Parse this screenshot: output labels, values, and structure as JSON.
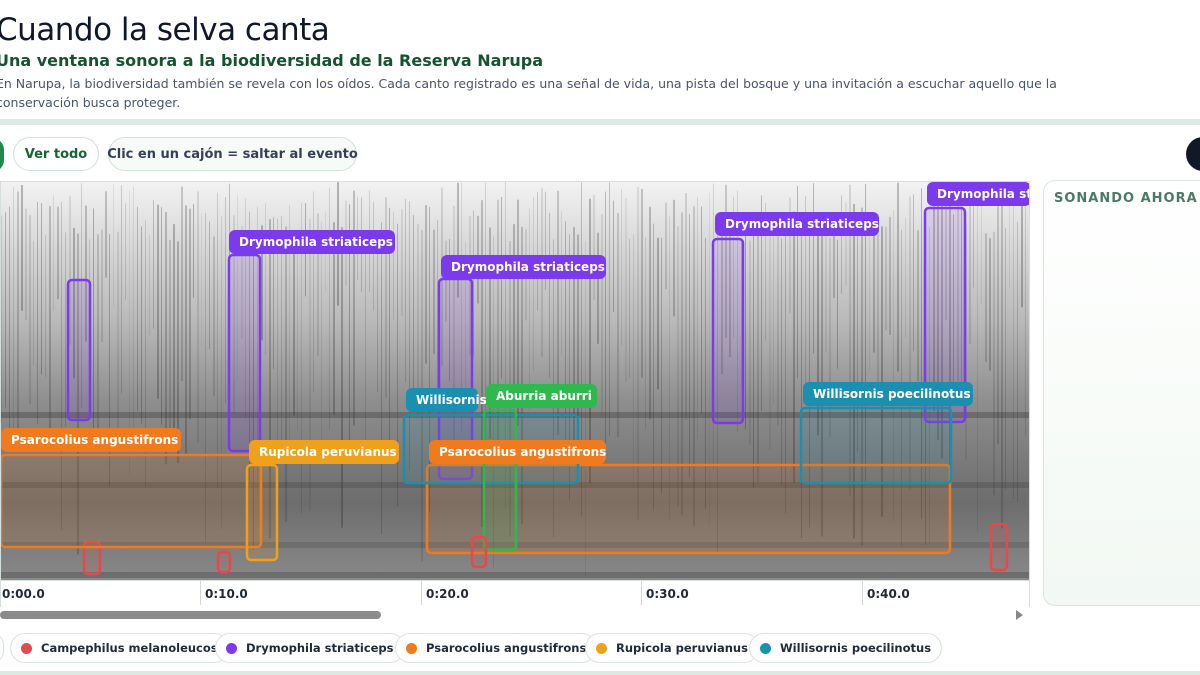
{
  "header": {
    "title": "Cuando la selva canta",
    "subtitle": "Una ventana sonora a la biodiversidad de la Reserva Narupa",
    "intro": "En Narupa, la biodiversidad también se revela con los oídos. Cada canto registrado es una señal de vida, una pista del bosque y una invitación a escuchar aquello que la conservación busca proteger."
  },
  "toolbar": {
    "view_all_label": "Ver todo",
    "hint_label": "Clic en un cajón = saltar al evento"
  },
  "spectrogram": {
    "time_ticks": [
      "0:00.0",
      "0:10.0",
      "0:20.0",
      "0:30.0",
      "0:40.0"
    ],
    "scroll_position_fraction": 0.37,
    "detections": [
      {
        "species": "Campephilus melanoleucos",
        "label": "",
        "color": "#e5484d"
      },
      {
        "species": "Drymophila striaticeps",
        "label": "",
        "color": "#7c3aed"
      },
      {
        "species": "Drymophila striaticeps",
        "label": "Drymophila striaticeps",
        "color": "#7c3aed"
      },
      {
        "species": "Drymophila striaticeps",
        "label": "Drymophila striaticeps",
        "color": "#7c3aed"
      },
      {
        "species": "Drymophila striaticeps",
        "label": "Drymophila striaticeps",
        "color": "#7c3aed"
      },
      {
        "species": "Drymophila striaticeps",
        "label": "Drymophila sti",
        "color": "#7c3aed"
      },
      {
        "species": "Psarocolius angustifrons",
        "label": "Psarocolius angustifrons",
        "color": "#f07a1e"
      },
      {
        "species": "Psarocolius angustifrons",
        "label": "Psarocolius angustifrons",
        "color": "#f07a1e"
      },
      {
        "species": "Rupicola peruvianus",
        "label": "Rupicola peruvianus",
        "color": "#f0a11c"
      },
      {
        "species": "Willisornis poecilinotus",
        "label": "Willisornis",
        "color": "#1b8fb0"
      },
      {
        "species": "Willisornis poecilinotus",
        "label": "Willisornis poecilinotus",
        "color": "#1b8fb0"
      },
      {
        "species": "Aburria aburri",
        "label": "Aburria aburri",
        "color": "#2fb84d"
      }
    ]
  },
  "now_playing": {
    "title": "SONANDO AHORA"
  },
  "legend": [
    {
      "name": "Campephilus melanoleucos",
      "color": "#e5484d"
    },
    {
      "name": "Drymophila striaticeps",
      "color": "#7c3aed"
    },
    {
      "name": "Psarocolius angustifrons",
      "color": "#f07a1e"
    },
    {
      "name": "Rupicola peruvianus",
      "color": "#f0a11c"
    },
    {
      "name": "Willisornis poecilinotus",
      "color": "#1b8fb0"
    }
  ]
}
